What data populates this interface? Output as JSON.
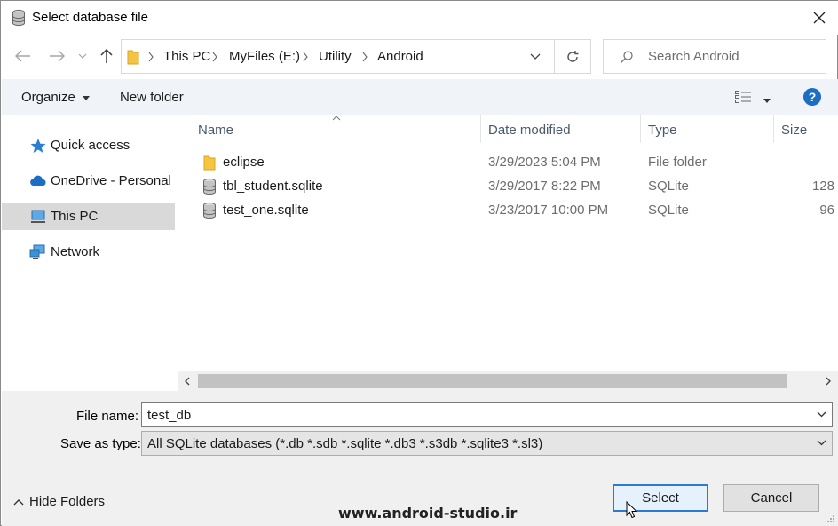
{
  "window": {
    "title": "Select database file"
  },
  "nav": {
    "back_icon": "arrow-left-icon",
    "forward_icon": "arrow-right-icon",
    "recent_icon": "chevron-down-icon",
    "up_icon": "arrow-up-icon"
  },
  "address": {
    "crumbs": [
      "This PC",
      "MyFiles (E:)",
      "Utility",
      "Android"
    ]
  },
  "search": {
    "placeholder": "Search Android"
  },
  "toolbar": {
    "organize": "Organize",
    "new_folder": "New folder",
    "help": "?"
  },
  "sidebar": {
    "items": [
      {
        "label": "Quick access",
        "icon": "star-icon"
      },
      {
        "label": "OneDrive - Personal",
        "icon": "cloud-icon"
      },
      {
        "label": "This PC",
        "icon": "computer-icon",
        "selected": true
      },
      {
        "label": "Network",
        "icon": "network-icon"
      }
    ]
  },
  "columns": {
    "name": "Name",
    "date": "Date modified",
    "type": "Type",
    "size": "Size"
  },
  "files": [
    {
      "name": "eclipse",
      "date": "3/29/2023 5:04 PM",
      "type": "File folder",
      "size": "",
      "icon": "folder-icon"
    },
    {
      "name": "tbl_student.sqlite",
      "date": "3/29/2017 8:22 PM",
      "type": "SQLite",
      "size": "128",
      "icon": "database-icon"
    },
    {
      "name": "test_one.sqlite",
      "date": "3/23/2017 10:00 PM",
      "type": "SQLite",
      "size": "96",
      "icon": "database-icon"
    }
  ],
  "form": {
    "file_name_label": "File name:",
    "file_name_value": "test_db",
    "save_type_label": "Save as type:",
    "save_type_value": "All SQLite databases (*.db *.sdb *.sqlite *.db3 *.s3db *.sqlite3 *.sl3)"
  },
  "footer": {
    "hide_folders": "Hide Folders",
    "select": "Select",
    "cancel": "Cancel",
    "watermark": "www.android-studio.ir"
  },
  "colors": {
    "accent": "#1b6ec2",
    "toolbar_bg": "#f0f4f9",
    "selected_bg": "#d9d9d9"
  }
}
